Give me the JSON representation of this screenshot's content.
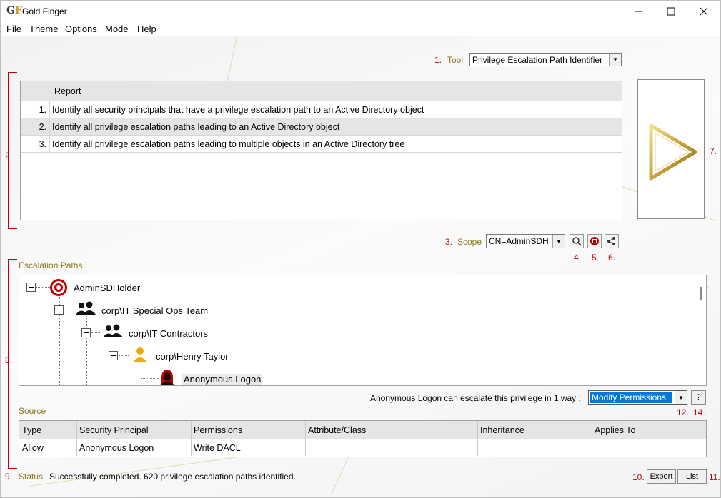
{
  "window": {
    "title": "Gold Finger",
    "logo_text": "GF"
  },
  "menu": [
    "File",
    "Theme",
    "Options",
    "Mode",
    "Help"
  ],
  "tool": {
    "number": "1.",
    "label": "Tool",
    "value": "Privilege Escalation Path Identifier"
  },
  "reports": {
    "number": "2.",
    "header": "Report",
    "rows": [
      {
        "n": "1.",
        "text": "Identify all security principals that have a privilege escalation path to an Active Directory object"
      },
      {
        "n": "2.",
        "text": "Identify all privilege escalation paths leading to an Active Directory object"
      },
      {
        "n": "3.",
        "text": "Identify all privilege escalation paths leading to multiple objects in an Active Directory tree"
      }
    ]
  },
  "run": {
    "number": "7."
  },
  "scope": {
    "number": "3.",
    "label": "Scope",
    "value": "CN=AdminSDH",
    "btn_nums": [
      "4.",
      "5.",
      "6."
    ]
  },
  "escalation": {
    "number": "8.",
    "label": "Escalation Paths",
    "nodes": [
      {
        "label": "AdminSDHolder",
        "icon": "target-icon"
      },
      {
        "label": "corp\\IT Special Ops Team",
        "icon": "group-icon"
      },
      {
        "label": "corp\\IT Contractors",
        "icon": "group-icon"
      },
      {
        "label": "corp\\Henry Taylor",
        "icon": "user-icon"
      },
      {
        "label": "Anonymous Logon",
        "icon": "hacker-icon"
      }
    ]
  },
  "escalate": {
    "text": "Anonymous Logon can escalate this privilege in 1 way :",
    "value": "Modify Permissions",
    "help": "?",
    "nums": [
      "12.",
      "14."
    ]
  },
  "source": {
    "label": "Source",
    "columns": [
      "Type",
      "Security Principal",
      "Permissions",
      "Attribute/Class",
      "Inheritance",
      "Applies To"
    ],
    "row": [
      "Allow",
      "Anonymous Logon",
      "Write DACL",
      "",
      "",
      ""
    ]
  },
  "status": {
    "number": "9.",
    "label": "Status",
    "text": "Successfully completed. 620 privilege escalation paths identified."
  },
  "footer": {
    "export_num": "10.",
    "export": "Export",
    "list": "List",
    "list_num": "11."
  },
  "colors": {
    "accent_red": "#c00000",
    "olive": "#8b7a1a",
    "gold": "#c9a43a",
    "selection": "#0078d7"
  }
}
